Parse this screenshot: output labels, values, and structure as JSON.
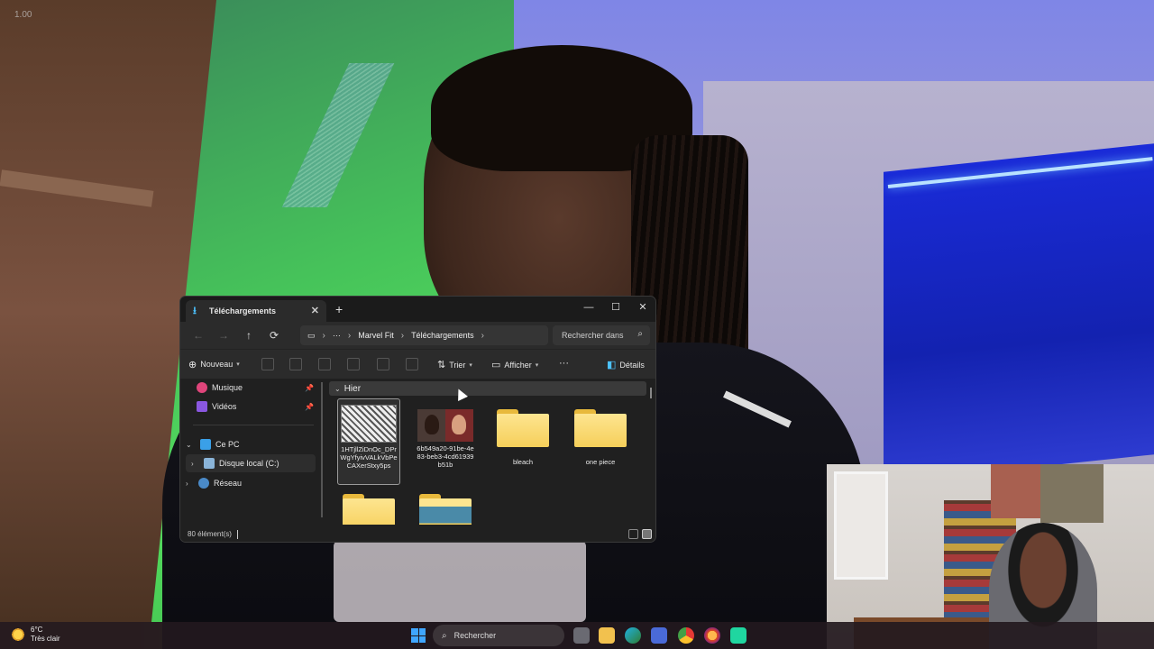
{
  "overlay": {
    "zoom": "1.00"
  },
  "explorer": {
    "tab": {
      "title": "Téléchargements",
      "close": "✕",
      "new_tab": "+"
    },
    "window_controls": {
      "minimize": "—",
      "maximize": "☐",
      "close": "✕"
    },
    "nav": {
      "back": "←",
      "forward": "→",
      "up": "↑",
      "refresh": "⟳"
    },
    "breadcrumb": [
      "Marvel Fit",
      "Téléchargements"
    ],
    "search_placeholder": "Rechercher dans",
    "toolbar": {
      "new_label": "Nouveau",
      "sort_label": "Trier",
      "view_label": "Afficher",
      "more": "···",
      "details_label": "Détails"
    },
    "sidebar": {
      "quick_access": [
        {
          "label": "Musique",
          "color": "#e0457b"
        },
        {
          "label": "Vidéos",
          "color": "#8a57e0"
        }
      ],
      "this_pc": "Ce PC",
      "local_disk": "Disque local (C:)",
      "network": "Réseau"
    },
    "group": {
      "label": "Hier"
    },
    "items": [
      {
        "name": "1HTjllZiDnOc_DPrWgYfyivVALkVbPeCAXerStxy5ps",
        "type": "image"
      },
      {
        "name": "6b549a20-91be-4e83-beb3-4cd61939b51b",
        "type": "video"
      },
      {
        "name": "bleach",
        "type": "folder"
      },
      {
        "name": "one piece",
        "type": "folder"
      },
      {
        "name": "",
        "type": "folder"
      },
      {
        "name": "",
        "type": "folder-image"
      }
    ],
    "status": "80 élément(s)"
  },
  "taskbar": {
    "weather_temp": "6°C",
    "weather_desc": "Très clair",
    "search_label": "Rechercher"
  }
}
